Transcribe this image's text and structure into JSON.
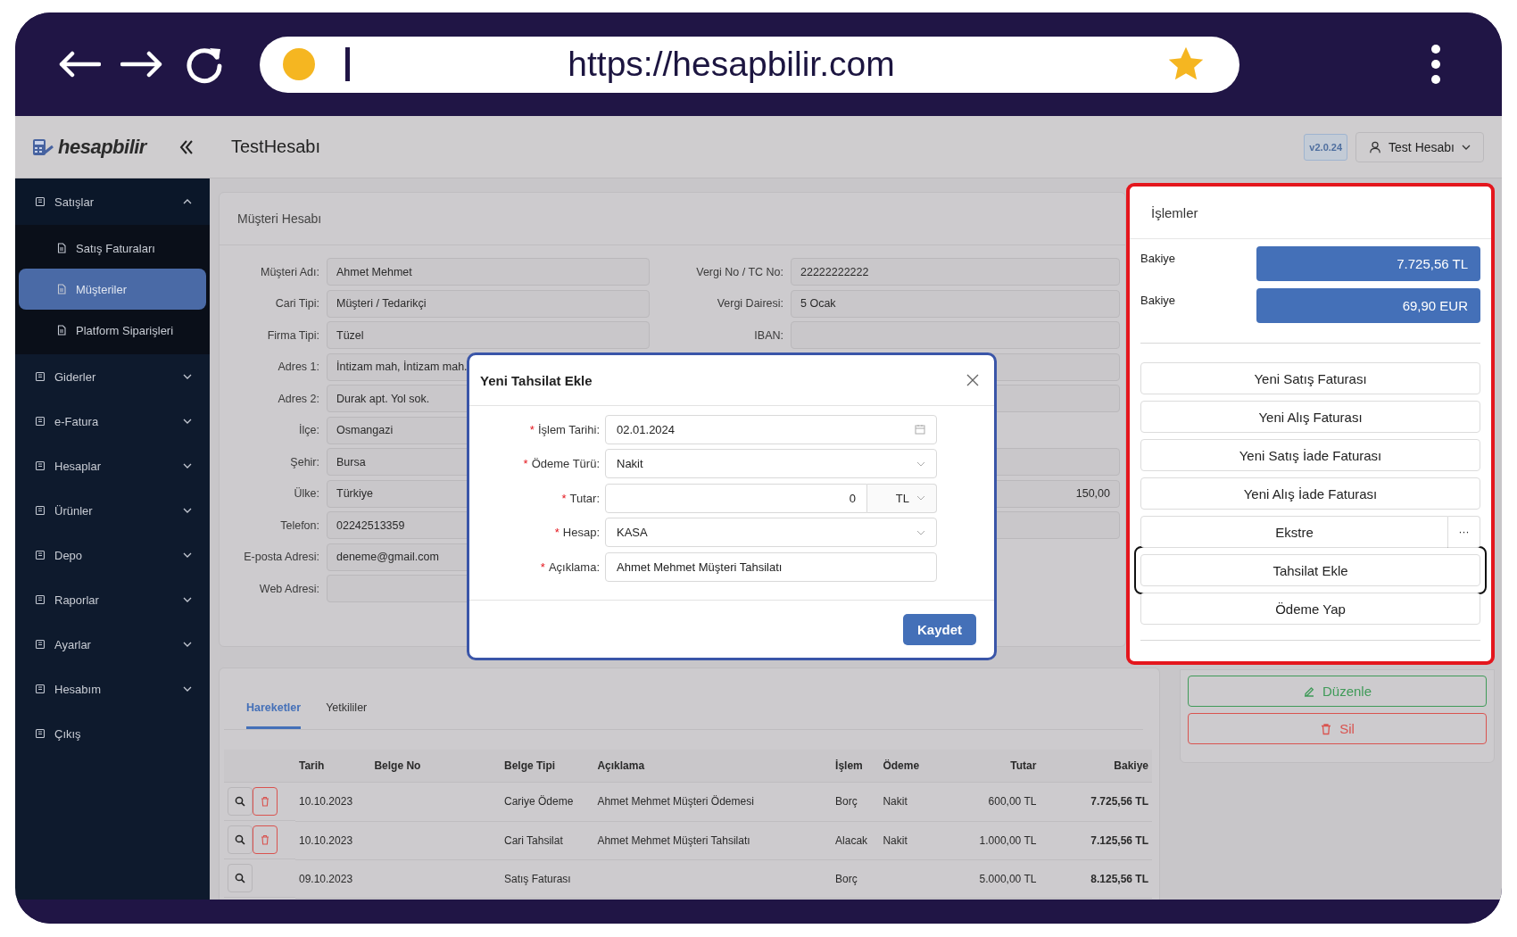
{
  "browser": {
    "url": "https://hesapbilir.com"
  },
  "header": {
    "logo": "hesapbilir",
    "title": "TestHesabı",
    "version": "v2.0.24",
    "user": "Test Hesabı"
  },
  "sidebar": {
    "items": [
      {
        "label": "Satışlar",
        "kind": "group",
        "expanded": true,
        "children": [
          {
            "label": "Satış Faturaları",
            "selected": false
          },
          {
            "label": "Müşteriler",
            "selected": true
          },
          {
            "label": "Platform Siparişleri",
            "selected": false
          }
        ]
      },
      {
        "label": "Giderler",
        "kind": "group",
        "expanded": false
      },
      {
        "label": "e-Fatura",
        "kind": "group",
        "expanded": false
      },
      {
        "label": "Hesaplar",
        "kind": "group",
        "expanded": false
      },
      {
        "label": "Ürünler",
        "kind": "group",
        "expanded": false
      },
      {
        "label": "Depo",
        "kind": "group",
        "expanded": false
      },
      {
        "label": "Raporlar",
        "kind": "group",
        "expanded": false
      },
      {
        "label": "Ayarlar",
        "kind": "group",
        "expanded": false
      },
      {
        "label": "Hesabım",
        "kind": "group",
        "expanded": false
      },
      {
        "label": "Çıkış",
        "kind": "link"
      }
    ]
  },
  "customer_card": {
    "title": "Müşteri Hesabı",
    "left_fields": [
      {
        "label": "Müşteri Adı:",
        "value": "Ahmet Mehmet"
      },
      {
        "label": "Cari Tipi:",
        "value": "Müşteri / Tedarikçi"
      },
      {
        "label": "Firma Tipi:",
        "value": "Tüzel"
      },
      {
        "label": "Adres 1:",
        "value": "İntizam mah, İntizam mah."
      },
      {
        "label": "Adres 2:",
        "value": "Durak apt. Yol sok."
      },
      {
        "label": "İlçe:",
        "value": "Osmangazi"
      },
      {
        "label": "Şehir:",
        "value": "Bursa"
      },
      {
        "label": "Ülke:",
        "value": "Türkiye"
      },
      {
        "label": "Telefon:",
        "value": "02242513359"
      },
      {
        "label": "E-posta Adresi:",
        "value": "deneme@gmail.com"
      },
      {
        "label": "Web Adresi:"
      }
    ],
    "right_fields": [
      {
        "kind": "field",
        "label": "Vergi No / TC No:",
        "value": "22222222222"
      },
      {
        "kind": "field",
        "label": "Vergi Dairesi:",
        "value": "5 Ocak"
      },
      {
        "kind": "field",
        "label": "IBAN:"
      },
      {
        "kind": "field"
      },
      {
        "kind": "field"
      },
      {
        "kind": "empty"
      },
      {
        "kind": "field"
      },
      {
        "kind": "number",
        "value": "150,00"
      },
      {
        "kind": "field"
      }
    ]
  },
  "modal": {
    "title": "Yeni Tahsilat Ekle",
    "fields": [
      {
        "kind": "date",
        "mark": "*",
        "label": "İşlem Tarihi:",
        "value": "02.01.2024"
      },
      {
        "kind": "select",
        "mark": "*",
        "label": "Ödeme Türü:",
        "value": "Nakit"
      },
      {
        "kind": "amount",
        "mark": "*",
        "label": "Tutar:",
        "value": "0",
        "currency": "TL"
      },
      {
        "kind": "select",
        "mark": "*",
        "label": "Hesap:",
        "value": "KASA"
      },
      {
        "kind": "text",
        "mark": "*",
        "label": "Açıklama:",
        "value": "Ahmet Mehmet Müşteri Tahsilatı"
      }
    ],
    "submit": "Kaydet"
  },
  "movements": {
    "tabs": [
      {
        "label": "Hareketler",
        "selected": true
      },
      {
        "label": "Yetkililer",
        "selected": false
      }
    ],
    "columns": [
      "Tarih",
      "Belge No",
      "Belge Tipi",
      "Açıklama",
      "İşlem",
      "Ödeme",
      "Tutar",
      "Bakiye"
    ],
    "rows": [
      {
        "deletable": true,
        "cells": [
          "10.10.2023",
          "",
          "Cariye Ödeme",
          "Ahmet Mehmet Müşteri Ödemesi",
          "Borç",
          "Nakit",
          "600,00 TL",
          "7.725,56 TL"
        ]
      },
      {
        "deletable": true,
        "cells": [
          "10.10.2023",
          "",
          "Cari Tahsilat",
          "Ahmet Mehmet Müşteri Tahsilatı",
          "Alacak",
          "Nakit",
          "1.000,00 TL",
          "7.125,56 TL"
        ]
      },
      {
        "deletable": false,
        "cells": [
          "09.10.2023",
          "",
          "Satış Faturası",
          "",
          "Borç",
          "",
          "5.000,00 TL",
          "8.125,56 TL"
        ]
      }
    ]
  },
  "operations": {
    "title": "İşlemler",
    "balances": [
      {
        "label": "Bakiye",
        "amount": "7.725,56 TL"
      },
      {
        "label": "Bakiye",
        "amount": "69,90 EUR"
      }
    ],
    "buttons": [
      {
        "kind": "button",
        "label": "Yeni Satış Faturası",
        "highlighted": false
      },
      {
        "kind": "button",
        "label": "Yeni Alış Faturası",
        "highlighted": false
      },
      {
        "kind": "button",
        "label": "Yeni Satış İade Faturası",
        "highlighted": false
      },
      {
        "kind": "button",
        "label": "Yeni Alış İade Faturası",
        "highlighted": false
      },
      {
        "kind": "split",
        "label": "Ekstre",
        "more": "···",
        "highlighted": false
      },
      {
        "kind": "button",
        "label": "Tahsilat Ekle",
        "highlighted": true
      },
      {
        "kind": "button",
        "label": "Ödeme Yap",
        "highlighted": false
      }
    ]
  },
  "actions": [
    {
      "kind": "edit",
      "label": "Düzenle"
    },
    {
      "kind": "delete",
      "label": "Sil"
    }
  ]
}
